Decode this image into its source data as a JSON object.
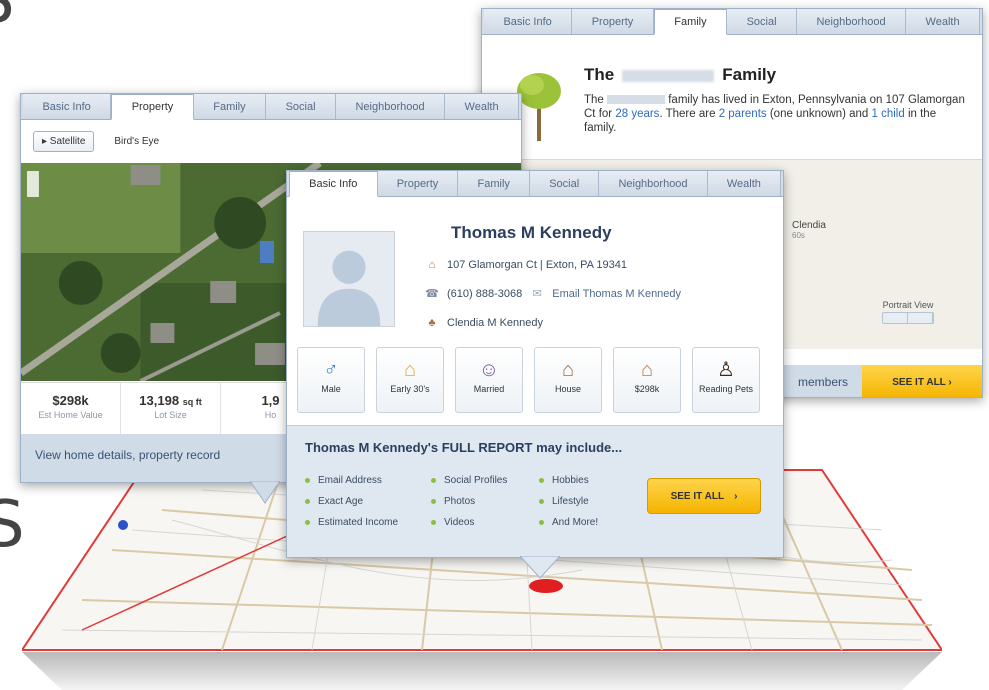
{
  "partial_letters": {
    "top": "S",
    "bottom": "S"
  },
  "family_window": {
    "tabs": [
      "Basic Info",
      "Property",
      "Family",
      "Social",
      "Neighborhood",
      "Wealth"
    ],
    "active_tab": "Family",
    "title_prefix": "The",
    "title_suffix": "Family",
    "desc_a": "The",
    "desc_b": "family has lived in Exton, Pennsylvania on 107 Glamorgan Ct for",
    "years_link": "28 years",
    "desc_c": ". There are",
    "parents_link": "2 parents",
    "desc_d": "(one unknown) and",
    "child_link": "1 child",
    "desc_e": "in the family.",
    "map_place": "Clendia",
    "map_place_sub": "60s",
    "portrait_label": "Portrait View",
    "footer_members": "members",
    "footer_button": "SEE IT ALL ›"
  },
  "property_window": {
    "tabs": [
      "Basic Info",
      "Property",
      "Family",
      "Social",
      "Neighborhood",
      "Wealth"
    ],
    "active_tab": "Property",
    "satellite_button": "▸ Satellite",
    "birds_eye": "Bird's Eye",
    "stats": [
      {
        "value": "$298k",
        "unit": "",
        "label": "Est Home Value"
      },
      {
        "value": "13,198",
        "unit": "sq ft",
        "label": "Lot Size"
      },
      {
        "value": "1,9",
        "unit": "",
        "label": "Ho"
      }
    ],
    "footer_text": "View home details, property record"
  },
  "basic_window": {
    "tabs": [
      "Basic Info",
      "Property",
      "Family",
      "Social",
      "Neighborhood",
      "Wealth"
    ],
    "active_tab": "Basic Info",
    "name": "Thomas M Kennedy",
    "address": "107 Glamorgan Ct | Exton, PA 19341",
    "phone": "(610) 888-3068",
    "email_link": "Email Thomas M Kennedy",
    "relative": "Clendia M Kennedy",
    "traits": [
      {
        "icon": "male-icon",
        "glyph": "♂",
        "label": "Male"
      },
      {
        "icon": "cake-icon",
        "glyph": "⌂",
        "label": "Early 30's"
      },
      {
        "icon": "couple-icon",
        "glyph": "☺",
        "label": "Married"
      },
      {
        "icon": "house-icon",
        "glyph": "⌂",
        "label": "House"
      },
      {
        "icon": "home-value-icon",
        "glyph": "⌂",
        "label": "$298k"
      },
      {
        "icon": "pet-icon",
        "glyph": "♙",
        "label": "Reading Pets"
      }
    ],
    "report_title": "Thomas M Kennedy's FULL REPORT may include...",
    "report_col1": [
      "Email Address",
      "Exact Age",
      "Estimated Income"
    ],
    "report_col2": [
      "Social Profiles",
      "Photos",
      "Videos"
    ],
    "report_col3": [
      "Hobbies",
      "Lifestyle",
      "And More!"
    ],
    "report_button": "SEE IT ALL",
    "report_button_arrow": "›"
  },
  "colors": {
    "accent_yellow": "#f4b400",
    "link_blue": "#2f6bbf",
    "tab_bar": "#d3dde8",
    "pin_red": "#e02020"
  }
}
